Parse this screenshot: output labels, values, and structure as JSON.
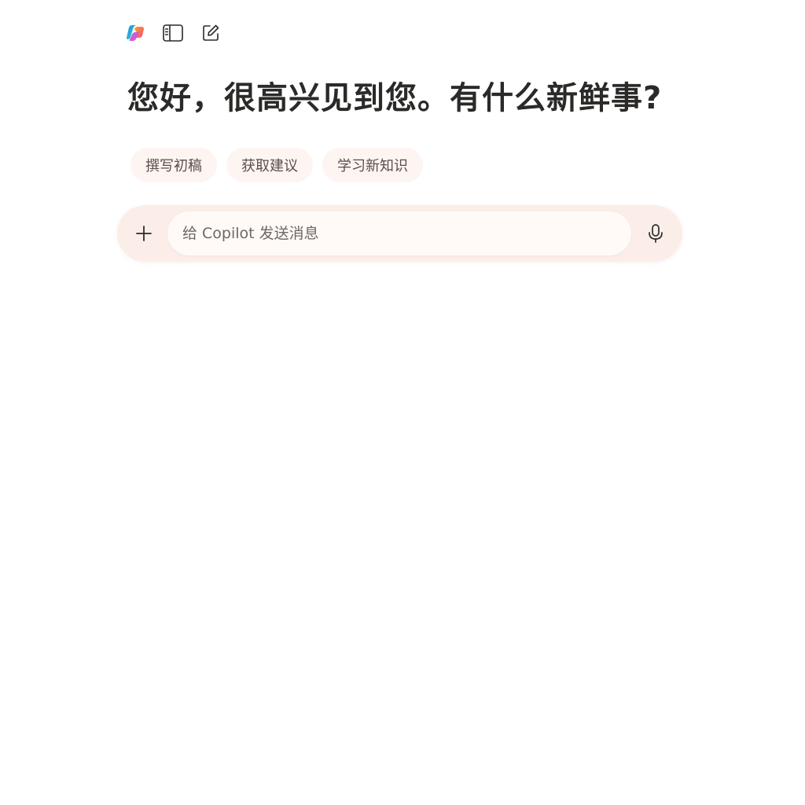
{
  "header": {
    "icons": {
      "logo": "copilot-logo-icon",
      "sidebar": "sidebar-toggle-icon",
      "compose": "new-chat-icon"
    }
  },
  "main": {
    "greeting": "您好，很高兴见到您。有什么新鲜事?",
    "suggestions": [
      {
        "label": "撰写初稿"
      },
      {
        "label": "获取建议"
      },
      {
        "label": "学习新知识"
      }
    ]
  },
  "composer": {
    "placeholder": "给 Copilot 发送消息",
    "value": "",
    "icons": {
      "add": "plus-icon",
      "mic": "microphone-icon"
    }
  },
  "colors": {
    "background": "#ffffff",
    "heading": "#2b2a28",
    "chip_bg": "#fcf5f1",
    "composer_bg": "#fbeee8",
    "input_bg": "#fffaf7"
  }
}
